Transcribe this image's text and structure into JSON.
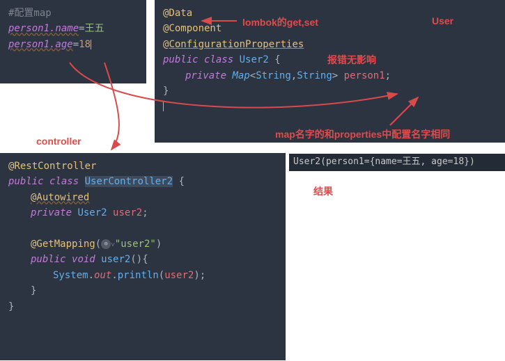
{
  "properties": {
    "comment": "#配置map",
    "line1_key": "person1.name",
    "line1_val": "王五",
    "line2_key": "person1.age",
    "line2_val": "18"
  },
  "user": {
    "anno_data": "@Data",
    "anno_component": "@Component",
    "anno_config_at": "@",
    "anno_config": "ConfigurationProperties",
    "kw_public": "public",
    "kw_class": "class",
    "class_name": "User2",
    "brace_open": "{",
    "kw_private": "private",
    "type_map": "Map",
    "generic_open": "<",
    "type_string": "String",
    "comma": ",",
    "generic_close": ">",
    "field_name": "person1",
    "semicolon": ";",
    "brace_close": "}"
  },
  "labels": {
    "lombok": "lombok的get,set",
    "user_title": "User",
    "config_note": "报错无影响",
    "map_note": "map名字的和properties中配置名字相同",
    "controller_title": "controller",
    "result_title": "结果"
  },
  "controller": {
    "anno_rest": "@RestController",
    "kw_public": "public",
    "kw_class": "class",
    "class_name": "UserController2",
    "brace_open": "{",
    "anno_autowired": "@Autowired",
    "kw_private": "private",
    "type_user2": "User2",
    "field_user2": "user2",
    "semicolon": ";",
    "anno_getmapping": "@GetMapping",
    "paren_open": "(",
    "str_user2": "\"user2\"",
    "paren_close": ")",
    "kw_void": "void",
    "method_user2": "user2",
    "empty_parens": "()",
    "brace_open2": "{",
    "sys": "System",
    "dot": ".",
    "out": "out",
    "println": "println",
    "arg": "user2",
    "brace_close": "}"
  },
  "result": {
    "text": "User2(person1={name=王五, age=18})"
  }
}
